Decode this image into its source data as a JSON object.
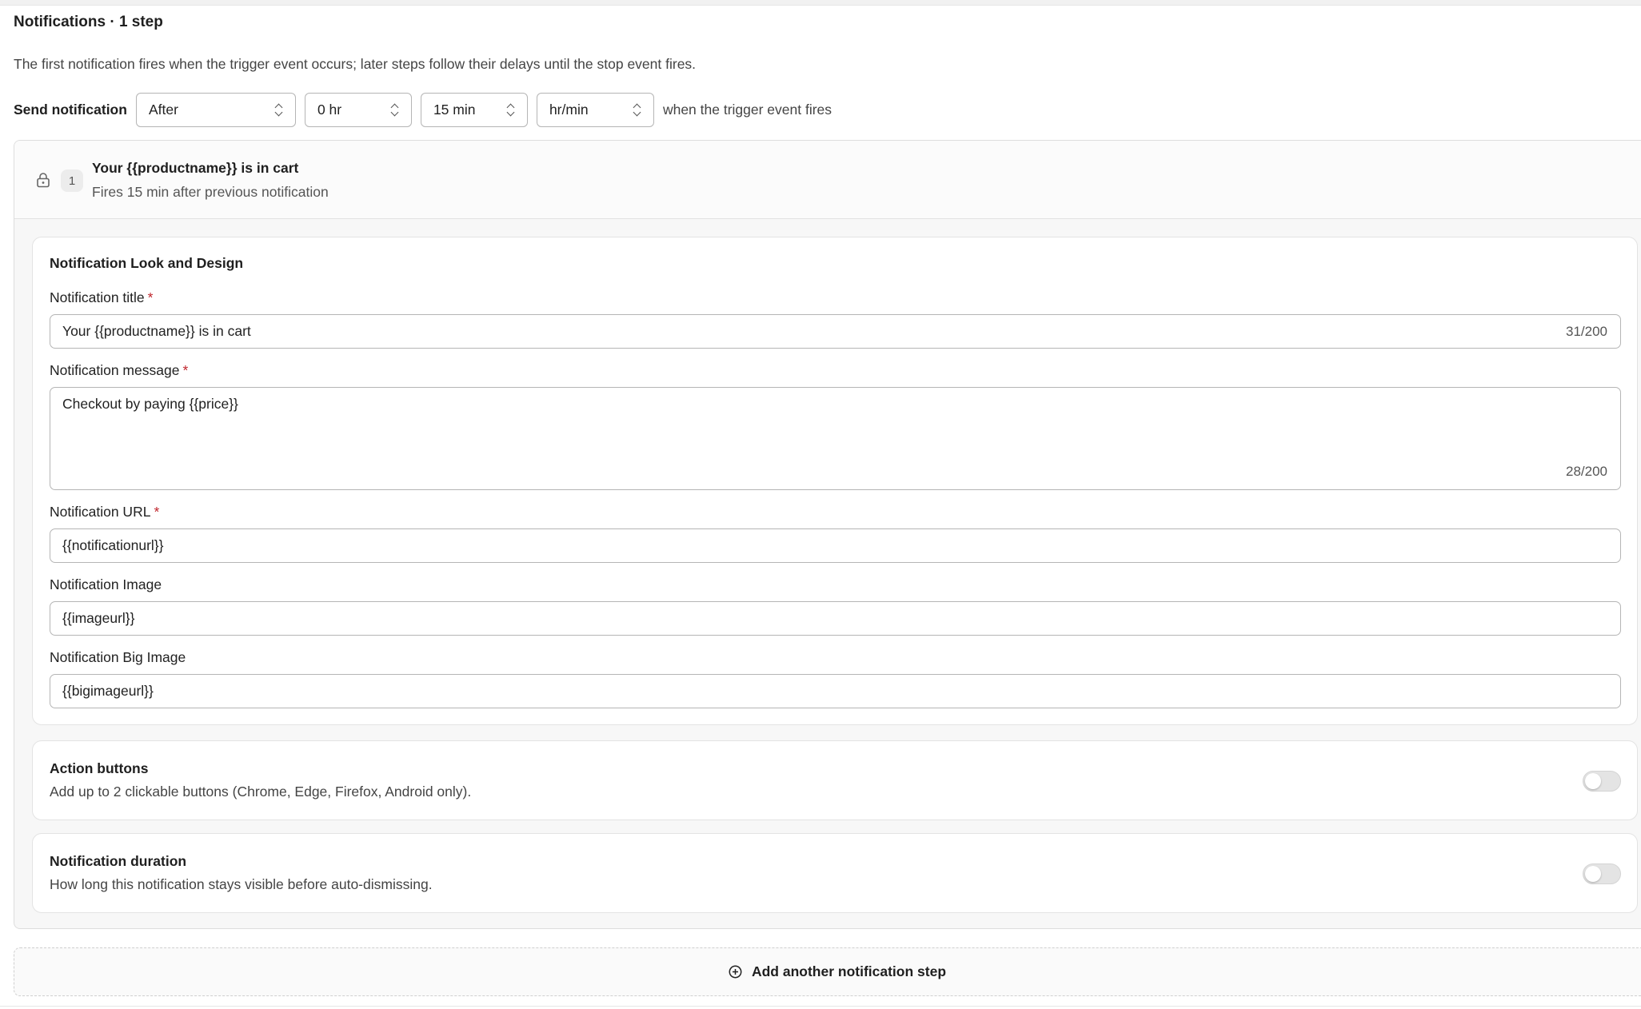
{
  "header": {
    "title": "Notifications · 1 step",
    "description": "The first notification fires when the trigger event occurs; later steps follow their delays until the stop event fires."
  },
  "send_row": {
    "label": "Send notification",
    "timing": "After",
    "hours": "0 hr",
    "minutes": "15 min",
    "unit": "hr/min",
    "suffix": "when the trigger event fires"
  },
  "step": {
    "number": "1",
    "title": "Your {{productname}} is in cart",
    "subtitle": "Fires 15 min after previous notification"
  },
  "design": {
    "section_title": "Notification Look and Design",
    "title_label": "Notification title",
    "title_value": "Your {{productname}} is in cart",
    "title_count": "31/200",
    "message_label": "Notification message",
    "message_value": "Checkout by paying {{price}}",
    "message_count": "28/200",
    "url_label": "Notification URL",
    "url_value": "{{notificationurl}}",
    "image_label": "Notification Image",
    "image_value": "{{imageurl}}",
    "big_image_label": "Notification Big Image",
    "big_image_value": "{{bigimageurl}}",
    "required_mark": "*"
  },
  "action_buttons": {
    "title": "Action buttons",
    "description": "Add up to 2 clickable buttons (Chrome, Edge, Firefox, Android only).",
    "enabled": false
  },
  "duration": {
    "title": "Notification duration",
    "description": "How long this notification stays visible before auto-dismissing.",
    "enabled": false
  },
  "add_step": {
    "label": "Add another notification step"
  },
  "icons": {
    "step_lock": "lock-icon",
    "add": "plus-circle-icon",
    "select": "chevron-up-down-icon"
  },
  "colors": {
    "required": "#c0262d",
    "border": "#b5b5b5",
    "card_bg": "#f7f7f7"
  }
}
